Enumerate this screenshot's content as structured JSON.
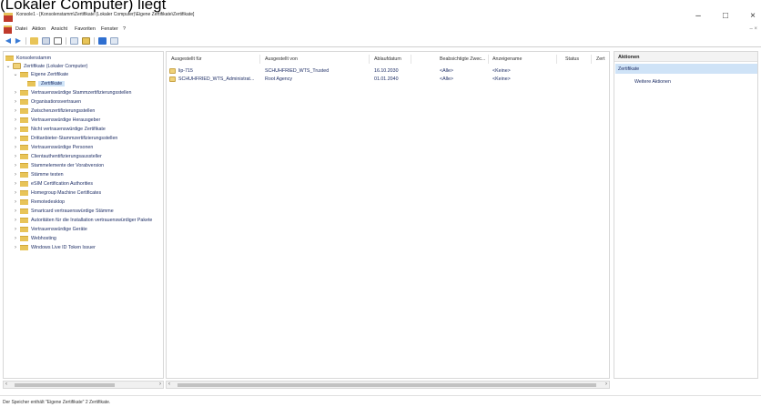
{
  "caption": "(Lokaler Computer) liegt",
  "window": {
    "title": "Konsole1 - [Konsolenstamm\\Zertifikate (Lokaler Computer)\\Eigene Zertifikate\\Zertifikate]",
    "minimize": "–",
    "maximize": "□",
    "close": "×"
  },
  "menu": {
    "items": [
      "Datei",
      "Aktion",
      "Ansicht",
      "Favoriten",
      "Fenster",
      "?"
    ],
    "right": "– ×"
  },
  "tree": {
    "root": "Konsolenstamm",
    "store": "Zertifikate (Lokaler Computer)",
    "personal": "Eigene Zertifikate",
    "selected": "Zertifikate",
    "stores": [
      "Vertrauenswürdige Stammzertifizierungsstellen",
      "Organisationsvertrauen",
      "Zwischenzertifizierungsstellen",
      "Vertrauenswürdige Herausgeber",
      "Nicht vertrauenswürdige Zertifikate",
      "Drittanbieter-Stammzertifizierungsstellen",
      "Vertrauenswürdige Personen",
      "Clientauthentifizierungsaussteller",
      "Stammelemente der Vorabversion",
      "Stämme testen",
      "eSIM Certification Authorities",
      "Homegroup Machine Certificates",
      "Remotedesktop",
      "Smartcard vertrauenswürdige Stämme",
      "Autoritäten für die Installation vertrauenswürdiger Pakete",
      "Vertrauenswürdige Geräte",
      "Webhosting",
      "Windows Live ID Token Issuer"
    ]
  },
  "list": {
    "columns": [
      "Ausgestellt für",
      "Ausgestellt von",
      "Ablaufdatum",
      "Beabsichtigte Zwec...",
      "Anzeigename",
      "Status",
      "Zert"
    ],
    "rows": [
      [
        "lip-715",
        "SCHUHFRIED_WTS_Trusted",
        "16.10.2030",
        "<Alle>",
        "<Keine>"
      ],
      [
        "SCHUHFRIED_WTS_Administrat...",
        "Root Agency",
        "01.01.2040",
        "<Alle>",
        "<Keine>"
      ]
    ]
  },
  "actions": {
    "header": "Aktionen",
    "section": "Zertifikate",
    "more": "Weitere Aktionen"
  },
  "status": {
    "text": "Der Speicher enthält \"Eigene Zertifikate\" 2 Zertifikate."
  }
}
